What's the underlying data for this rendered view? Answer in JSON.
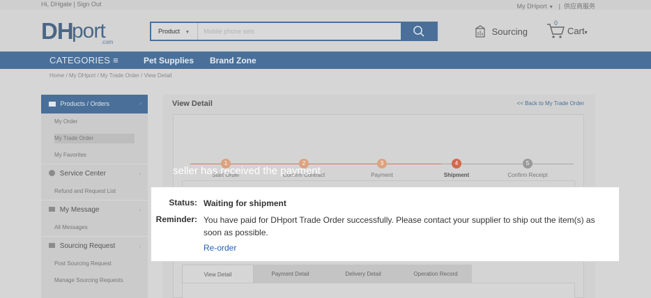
{
  "topbar": {
    "greeting": "Hi, DHgate",
    "separator": "|",
    "sign_out": "Sign Out",
    "my_dhport": "My DHport",
    "supplier_service": "供应商服务"
  },
  "header": {
    "logo_main": "DH",
    "logo_port": "port",
    "logo_suffix": ".com",
    "search_category": "Product",
    "search_placeholder": "Mobile phone sets",
    "sourcing_label": "Sourcing",
    "cart_label": "Cart",
    "cart_count": "0"
  },
  "nav": {
    "categories": "CATEGORIES ≡",
    "links": [
      "Pet Supplies",
      "Brand Zone"
    ]
  },
  "breadcrumb": "Home  /  My DHport  /  My Trade Order  /  View Detail",
  "sidebar": {
    "header": "Products / Orders",
    "items": [
      "My Order",
      "My Trade Order",
      "My Favorites"
    ],
    "sections": [
      {
        "label": "Service Center",
        "items": [
          "Refund and Request List"
        ]
      },
      {
        "label": "My Message",
        "items": [
          "All Messages"
        ]
      },
      {
        "label": "Sourcing Request",
        "items": [
          "Post Sourcing Request",
          "Manage Sourcing Requests"
        ]
      }
    ]
  },
  "main": {
    "title": "View Detail",
    "back_link": "<< Back to My Trade Order",
    "steps": [
      {
        "num": "1",
        "label": "Start Order"
      },
      {
        "num": "2",
        "label": "Confirm Contract"
      },
      {
        "num": "3",
        "label": "Payment"
      },
      {
        "num": "4",
        "label": "Shipment"
      },
      {
        "num": "5",
        "label": "Confirm Receipt"
      }
    ],
    "current_step": 4,
    "tabs": [
      "View Detail",
      "Payment Detail",
      "Delivery Detail",
      "Operation Record"
    ]
  },
  "caption": "seller has received the payment",
  "popup": {
    "status_key": "Status:",
    "status_value": "Waiting for shipment",
    "reminder_key": "Reminder:",
    "reminder_value": "You have paid for DHport Trade Order successfully. Please contact your supplier to ship out the item(s) as soon as possible.",
    "reorder": "Re-order"
  },
  "colors": {
    "brand": "#4a7099",
    "step_done": "#dda27f",
    "step_current": "#d2694e",
    "link": "#1f5fb8"
  }
}
